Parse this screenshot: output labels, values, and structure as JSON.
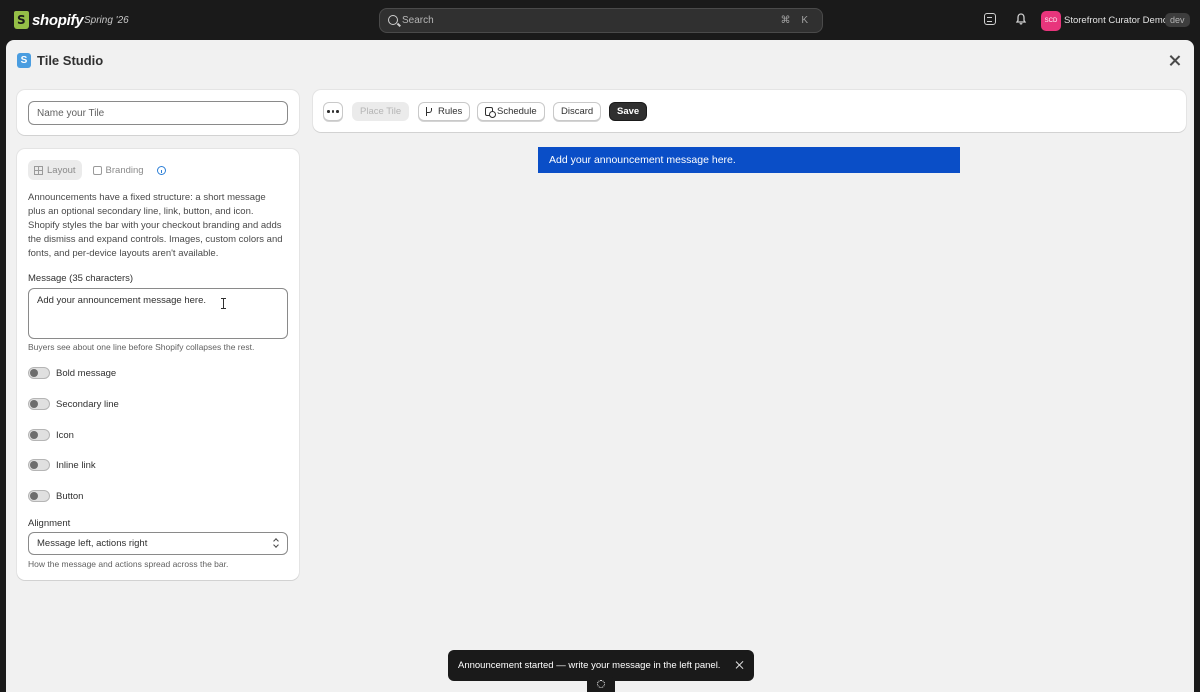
{
  "topbar": {
    "brand": "shopify",
    "edition": "Spring '26",
    "search_placeholder": "Search",
    "search_shortcut": "⌘ K",
    "avatar_initials": "SCD",
    "avatar_color": "#e8357c",
    "store_name": "Storefront Curator Demo",
    "env_badge": "dev"
  },
  "modal": {
    "title": "Tile Studio",
    "tile_name_placeholder": "Name your Tile",
    "tile_name_value": ""
  },
  "panel": {
    "tabs": [
      {
        "label": "Layout",
        "active": true
      },
      {
        "label": "Branding",
        "active": false
      }
    ],
    "description": "Announcements have a fixed structure: a short message plus an optional secondary line, link, button, and icon. Shopify styles the bar with your checkout branding and adds the dismiss and expand controls. Images, custom colors and fonts, and per-device layouts aren't available.",
    "message_label": "Message (35 characters)",
    "message_value": "Add your announcement message here.",
    "message_help": "Buyers see about one line before Shopify collapses the rest.",
    "toggles": [
      {
        "label": "Bold message",
        "on": false
      },
      {
        "label": "Secondary line",
        "on": false
      },
      {
        "label": "Icon",
        "on": false
      },
      {
        "label": "Inline link",
        "on": false
      },
      {
        "label": "Button",
        "on": false
      }
    ],
    "alignment_label": "Alignment",
    "alignment_value": "Message left, actions right",
    "alignment_help": "How the message and actions spread across the bar."
  },
  "toolbar": {
    "place_label": "Place Tile",
    "rules_label": "Rules",
    "schedule_label": "Schedule",
    "discard_label": "Discard",
    "save_label": "Save"
  },
  "preview": {
    "message": "Add your announcement message here.",
    "bar_color": "#0a4ec7"
  },
  "toast": {
    "message": "Announcement started — write your message in the left panel."
  }
}
